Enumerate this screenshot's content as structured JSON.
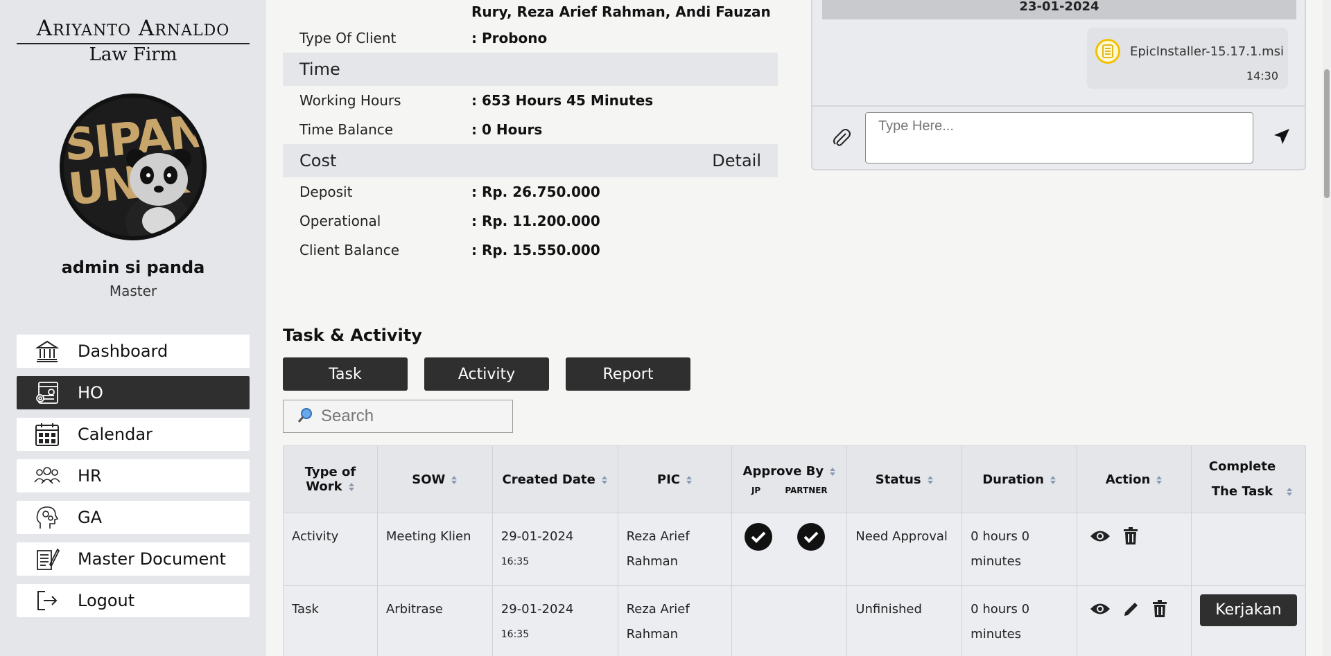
{
  "brand": {
    "line1": "Ariyanto Arnaldo",
    "line2": "Law Firm"
  },
  "avatar": {
    "text1": "SIPANDA",
    "text2": "UNIK"
  },
  "user": {
    "name": "admin si panda",
    "role": "Master"
  },
  "nav": [
    {
      "label": "Dashboard",
      "icon": "bank-icon",
      "active": false
    },
    {
      "label": "HO",
      "icon": "office-settings-icon",
      "active": true
    },
    {
      "label": "Calendar",
      "icon": "calendar-icon",
      "active": false
    },
    {
      "label": "HR",
      "icon": "people-icon",
      "active": false
    },
    {
      "label": "GA",
      "icon": "head-gears-icon",
      "active": false
    },
    {
      "label": "Master Document",
      "icon": "document-icon",
      "active": false
    },
    {
      "label": "Logout",
      "icon": "logout-icon",
      "active": false
    }
  ],
  "info": {
    "team_value": "Rury, Reza Arief Rahman, Andi Fauzan",
    "client_type": {
      "label": "Type Of Client",
      "value": ": Probono"
    },
    "time_section": "Time",
    "working_hours": {
      "label": "Working Hours",
      "value": ": 653 Hours 45 Minutes"
    },
    "time_balance": {
      "label": "Time Balance",
      "value": ": 0 Hours"
    },
    "cost_section": "Cost",
    "cost_detail": "Detail",
    "deposit": {
      "label": "Deposit",
      "value": ": Rp. 26.750.000"
    },
    "operational": {
      "label": "Operational",
      "value": ": Rp. 11.200.000"
    },
    "client_balance": {
      "label": "Client Balance",
      "value": ": Rp. 15.550.000"
    }
  },
  "chat": {
    "date": "23-01-2024",
    "file_name": "EpicInstaller-15.17.1.msi",
    "file_time": "14:30",
    "placeholder": "Type Here..."
  },
  "tasks": {
    "title": "Task & Activity",
    "tabs": [
      "Task",
      "Activity",
      "Report"
    ],
    "search_placeholder": "Search",
    "headers": {
      "type_of_work": "Type of Work",
      "sow": "SOW",
      "created_date": "Created Date",
      "pic": "PIC",
      "approve_by": "Approve By",
      "approve_jp": "JP",
      "approve_partner": "PARTNER",
      "status": "Status",
      "duration": "Duration",
      "action": "Action",
      "complete": "Complete The Task"
    },
    "rows": [
      {
        "type": "Activity",
        "sow": "Meeting Klien",
        "date": "29-01-2024",
        "time": "16:35",
        "pic": "Reza Arief Rahman",
        "approved_jp": true,
        "approved_partner": true,
        "status": "Need Approval",
        "duration": "0 hours 0 minutes",
        "can_edit": false,
        "complete_label": ""
      },
      {
        "type": "Task",
        "sow": "Arbitrase",
        "date": "29-01-2024",
        "time": "16:35",
        "pic": "Reza Arief Rahman",
        "approved_jp": false,
        "approved_partner": false,
        "status": "Unfinished",
        "duration": "0 hours 0 minutes",
        "can_edit": true,
        "complete_label": "Kerjakan"
      }
    ]
  }
}
